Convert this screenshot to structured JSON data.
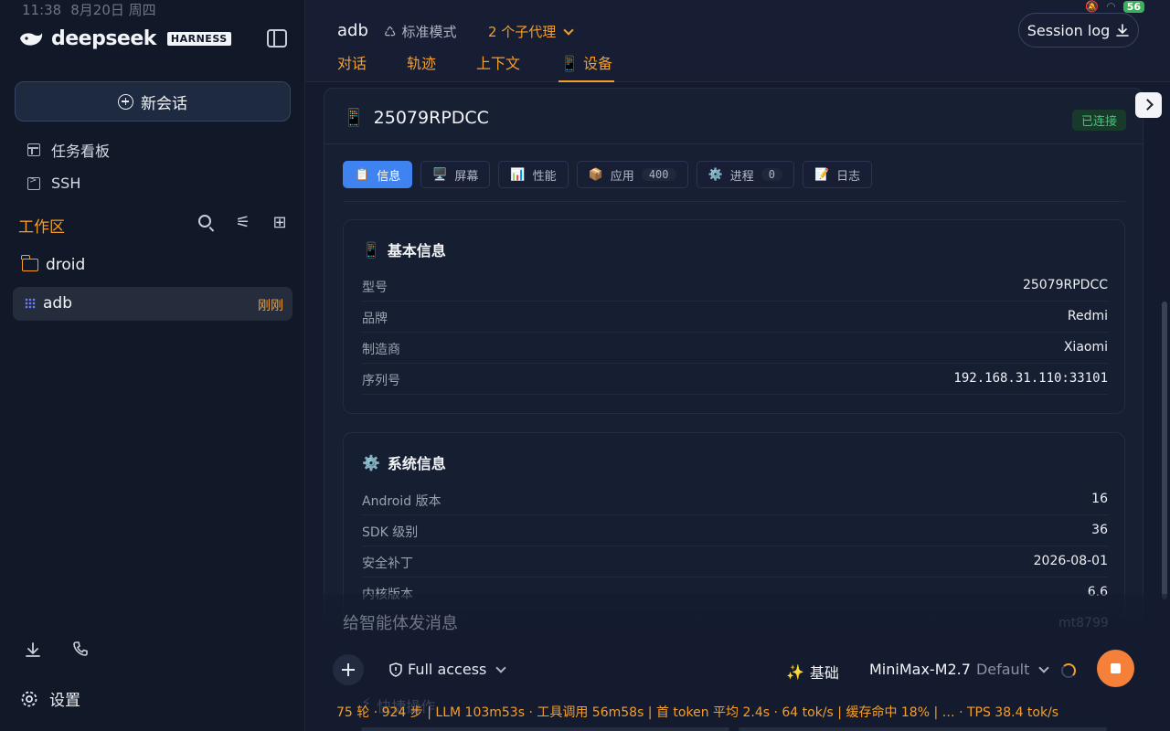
{
  "statusbar": {
    "time": "11:38",
    "date": "8月20日 周四",
    "battery": "56"
  },
  "sidebar": {
    "brand": "deepseek",
    "brand_tag": "HARNESS",
    "new_chat": "新会话",
    "links": [
      {
        "label": "任务看板"
      },
      {
        "label": "SSH"
      }
    ],
    "workspace_title": "工作区",
    "folder": "droid",
    "session": {
      "name": "adb",
      "time": "刚刚"
    },
    "settings": "设置"
  },
  "topbar": {
    "title": "adb",
    "mode": "标准模式",
    "agents": "2 个子代理",
    "session_log": "Session log",
    "tabs": [
      {
        "label": "对话"
      },
      {
        "label": "轨迹"
      },
      {
        "label": "上下文"
      },
      {
        "label": "📱 设备"
      }
    ]
  },
  "device": {
    "name": "25079RPDCC",
    "status": "已连接",
    "subtabs": [
      {
        "icon": "📋",
        "label": "信息"
      },
      {
        "icon": "🖥️",
        "label": "屏幕"
      },
      {
        "icon": "📊",
        "label": "性能"
      },
      {
        "icon": "📦",
        "label": "应用",
        "count": "400"
      },
      {
        "icon": "⚙️",
        "label": "进程",
        "count": "0"
      },
      {
        "icon": "📝",
        "label": "日志"
      }
    ],
    "basic_title": "基本信息",
    "basic": [
      {
        "k": "型号",
        "v": "25079RPDCC"
      },
      {
        "k": "品牌",
        "v": "Redmi"
      },
      {
        "k": "制造商",
        "v": "Xiaomi"
      },
      {
        "k": "序列号",
        "v": "192.168.31.110:33101"
      }
    ],
    "system_title": "系统信息",
    "system": [
      {
        "k": "Android 版本",
        "v": "16"
      },
      {
        "k": "SDK 级别",
        "v": "36"
      },
      {
        "k": "安全补丁",
        "v": "2026-08-01"
      },
      {
        "k": "内核版本",
        "v": "6.6"
      }
    ]
  },
  "composer": {
    "placeholder": "给智能体发消息",
    "hint": "mt8799",
    "access": "Full access",
    "basic": "基础",
    "model": "MiniMax-M2.7",
    "model_default": "Default",
    "quick": "快捷操作"
  },
  "stats": "75 轮 · 924 步  |  LLM 103m53s · 工具调用 56m58s  |  首 token 平均 2.4s · 64 tok/s  |  缓存命中 18%  |  …  · TPS 38.4 tok/s",
  "colors": {
    "accent": "#f59e2b",
    "primary": "#3f83f0",
    "success": "#42c778",
    "stop": "#f5803a"
  }
}
